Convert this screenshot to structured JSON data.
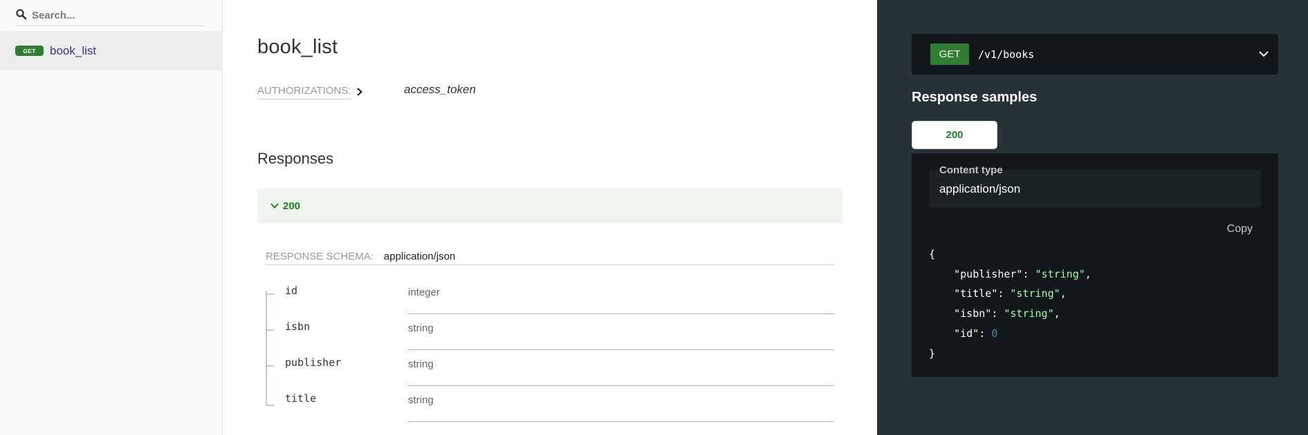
{
  "sidebar": {
    "search_placeholder": "Search...",
    "items": [
      {
        "method": "GET",
        "label": "book_list"
      }
    ]
  },
  "main": {
    "title": "book_list",
    "authorizations_label": "AUTHORIZATIONS:",
    "auth_token": "access_token",
    "responses_title": "Responses",
    "response_code": "200",
    "schema_label": "RESPONSE SCHEMA:",
    "schema_value": "application/json",
    "fields": [
      {
        "name": "id",
        "type": "integer"
      },
      {
        "name": "isbn",
        "type": "string"
      },
      {
        "name": "publisher",
        "type": "string"
      },
      {
        "name": "title",
        "type": "string"
      }
    ]
  },
  "right_panel": {
    "method": "GET",
    "path": "/v1/books",
    "samples_title": "Response samples",
    "tab_label": "200",
    "content_type_label": "Content type",
    "content_type_value": "application/json",
    "copy_label": "Copy",
    "json": {
      "open": "{",
      "close": "}",
      "entries": [
        {
          "key": "\"publisher\"",
          "value": "\"string\"",
          "kind": "str",
          "comma": ","
        },
        {
          "key": "\"title\"",
          "value": "\"string\"",
          "kind": "str",
          "comma": ","
        },
        {
          "key": "\"isbn\"",
          "value": "\"string\"",
          "kind": "str",
          "comma": ","
        },
        {
          "key": "\"id\"",
          "value": "0",
          "kind": "num",
          "comma": ""
        }
      ]
    }
  },
  "colors": {
    "get_green": "#2e7d32",
    "code_green": "#1d8127",
    "sidebar_link": "#32329f",
    "right_bg": "#263238",
    "code_bg": "#11171a",
    "json_string": "#a0fbaa",
    "json_number": "#4a8bb3"
  },
  "icons": {
    "search": "search-icon",
    "auth_chevron": "chevron-right-icon",
    "response_chevron": "chevron-down-icon",
    "endpoint_chevron": "chevron-down-icon"
  }
}
